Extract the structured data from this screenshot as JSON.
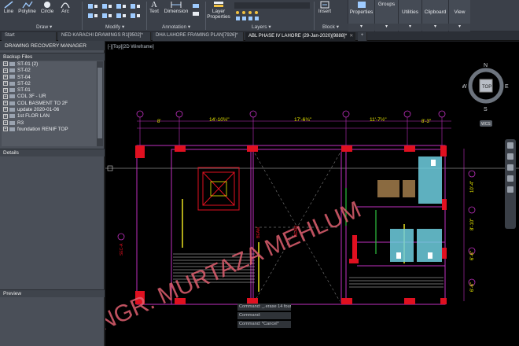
{
  "ribbon": {
    "draw_tools": [
      "Line",
      "Polyline",
      "Circle",
      "Arc"
    ],
    "text_tool": "Text",
    "dimension_tool": "Dimension",
    "layer_properties": "Layer\nProperties",
    "insert_tool": "Insert",
    "panels": {
      "draw": "Draw",
      "modify": "Modify",
      "annotation": "Annotation",
      "layers": "Layers",
      "block": "Block"
    },
    "right_buttons": [
      "Properties",
      "Groups",
      "Utilities",
      "Clipboard",
      "View"
    ]
  },
  "tabs": [
    {
      "label": "Start",
      "active": false
    },
    {
      "label": "NED KARACHI DRAWINGS R1[9502]*",
      "active": false
    },
    {
      "label": "DHA LAHORE FRAMING PLAN[7926]*",
      "active": false
    },
    {
      "label": "ABL PHASE IV LAHORE (29-Jan-2020)[9888]*",
      "active": true
    }
  ],
  "palette": {
    "title": "DRAWING RECOVERY MANAGER",
    "backup_header": "Backup Files",
    "backup_files": [
      "ST-01 (2)",
      "ST-02",
      "ST-04",
      "ST-02",
      "ST-01",
      "COL 3F - UR",
      "COL BASMENT TO 2F",
      "update 2020-01-06",
      "1st FLOR LAN",
      "R3",
      "foundation RENIF TOP"
    ],
    "details_header": "Details",
    "preview_header": "Preview"
  },
  "canvas": {
    "viewport_label": "[-][Top][2D Wireframe]",
    "viewcube": {
      "north": "N",
      "south": "S",
      "east": "E",
      "west": "W",
      "face": "TOP",
      "wcs": "WCS"
    },
    "dimensions": [
      "14'-10½\"",
      "17'-6¾\"",
      "11'-7½\"",
      "8'",
      "8'-3\""
    ],
    "watermark": "ENGR. MURTAZA MEHLUM",
    "command_history": [
      "Command: _.erase 14 found",
      "Command:",
      "Command: *Cancel*"
    ]
  },
  "colors": {
    "ribbon_bg": "#3b4049",
    "palette_bg": "#4a4f58",
    "canvas_bg": "#000000",
    "grid_line_magenta": "#c030c0",
    "column_red": "#e01020",
    "watermark": "#e06070"
  }
}
